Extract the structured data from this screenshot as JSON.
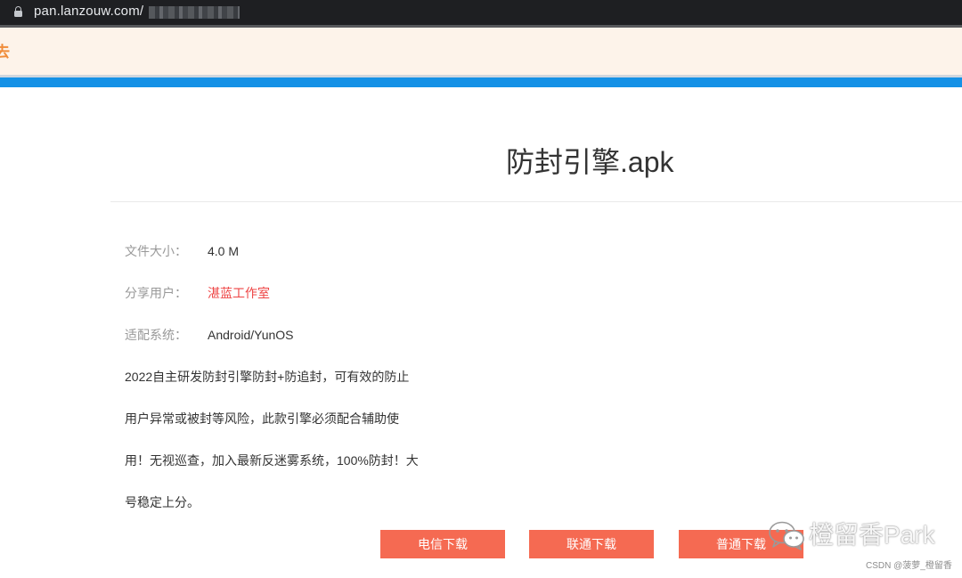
{
  "browser": {
    "url": "pan.lanzouw.com/"
  },
  "notice": {
    "partial_glyph": "去"
  },
  "file": {
    "title": "防封引擎.apk",
    "info": [
      {
        "label": "文件大小：",
        "value": "4.0 M"
      },
      {
        "label": "分享用户：",
        "value": "湛蓝工作室"
      },
      {
        "label": "适配系统：",
        "value": "Android/YunOS"
      }
    ],
    "description_lines": [
      "2022自主研发防封引擎防封+防追封，可有效的防止",
      "用户异常或被封等风险，此款引擎必须配合辅助使",
      "用！无视巡查，加入最新反迷雾系统，100%防封！大",
      "号稳定上分。"
    ]
  },
  "downloads": [
    {
      "label": "电信下载"
    },
    {
      "label": "联通下载"
    },
    {
      "label": "普通下载"
    }
  ],
  "watermark": {
    "text": "橙留香Park",
    "csdn": "CSDN @菠萝_橙留香",
    "icon": "wechat-icon"
  },
  "colors": {
    "accent_blue": "#1591e6",
    "button": "#f56a52",
    "uploader_link": "#ee4444",
    "notice_bg": "#fdf3ea"
  }
}
